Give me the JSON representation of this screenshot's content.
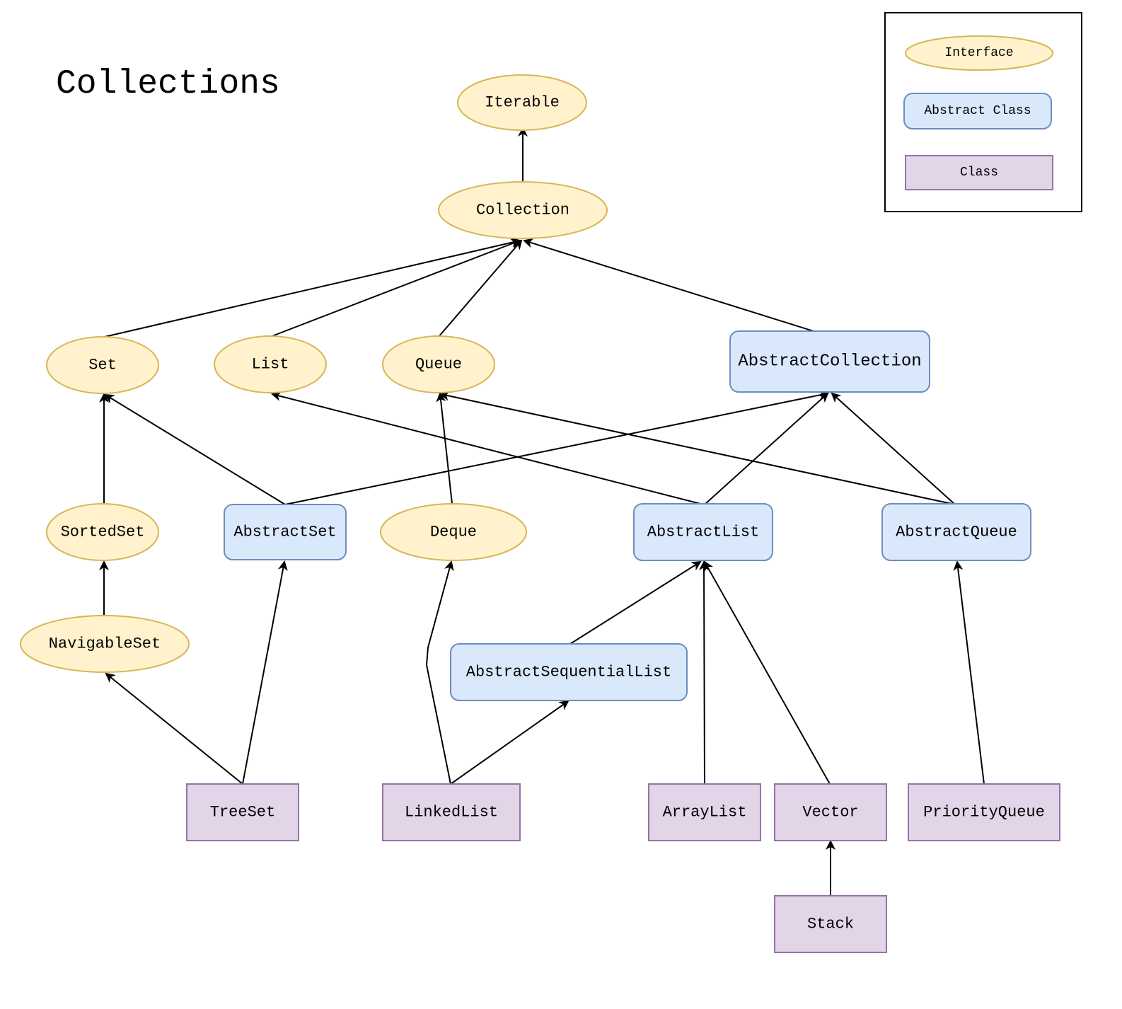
{
  "title": "Collections",
  "colors": {
    "interface_fill": "#fff2cc",
    "interface_stroke": "#d6b656",
    "abstract_fill": "#dae8fc",
    "abstract_stroke": "#6c8ebf",
    "class_fill": "#e1d5e7",
    "class_stroke": "#9673a6",
    "edge": "#000000"
  },
  "legend": {
    "items": [
      {
        "kind": "interface",
        "label": "Interface"
      },
      {
        "kind": "abstract",
        "label": "Abstract Class"
      },
      {
        "kind": "class",
        "label": "Class"
      }
    ]
  },
  "nodes": [
    {
      "id": "iterable",
      "kind": "interface",
      "label": "Iterable"
    },
    {
      "id": "collection",
      "kind": "interface",
      "label": "Collection"
    },
    {
      "id": "set",
      "kind": "interface",
      "label": "Set"
    },
    {
      "id": "list",
      "kind": "interface",
      "label": "List"
    },
    {
      "id": "queue",
      "kind": "interface",
      "label": "Queue"
    },
    {
      "id": "abstractcollection",
      "kind": "abstract",
      "label": "AbstractCollection"
    },
    {
      "id": "sortedset",
      "kind": "interface",
      "label": "SortedSet"
    },
    {
      "id": "abstractset",
      "kind": "abstract",
      "label": "AbstractSet"
    },
    {
      "id": "deque",
      "kind": "interface",
      "label": "Deque"
    },
    {
      "id": "abstractlist",
      "kind": "abstract",
      "label": "AbstractList"
    },
    {
      "id": "abstractqueue",
      "kind": "abstract",
      "label": "AbstractQueue"
    },
    {
      "id": "navigableset",
      "kind": "interface",
      "label": "NavigableSet"
    },
    {
      "id": "abstractsequentiallist",
      "kind": "abstract",
      "label": "AbstractSequentialList"
    },
    {
      "id": "treeset",
      "kind": "class",
      "label": "TreeSet"
    },
    {
      "id": "linkedlist",
      "kind": "class",
      "label": "LinkedList"
    },
    {
      "id": "arraylist",
      "kind": "class",
      "label": "ArrayList"
    },
    {
      "id": "vector",
      "kind": "class",
      "label": "Vector"
    },
    {
      "id": "priorityqueue",
      "kind": "class",
      "label": "PriorityQueue"
    },
    {
      "id": "stack",
      "kind": "class",
      "label": "Stack"
    }
  ],
  "edges": [
    {
      "from": "collection",
      "to": "iterable"
    },
    {
      "from": "set",
      "to": "collection"
    },
    {
      "from": "list",
      "to": "collection"
    },
    {
      "from": "queue",
      "to": "collection"
    },
    {
      "from": "abstractcollection",
      "to": "collection"
    },
    {
      "from": "sortedset",
      "to": "set"
    },
    {
      "from": "abstractset",
      "to": "set"
    },
    {
      "from": "abstractset",
      "to": "abstractcollection"
    },
    {
      "from": "deque",
      "to": "queue"
    },
    {
      "from": "abstractlist",
      "to": "list"
    },
    {
      "from": "abstractlist",
      "to": "abstractcollection"
    },
    {
      "from": "abstractqueue",
      "to": "queue"
    },
    {
      "from": "abstractqueue",
      "to": "abstractcollection"
    },
    {
      "from": "navigableset",
      "to": "sortedset"
    },
    {
      "from": "abstractsequentiallist",
      "to": "abstractlist"
    },
    {
      "from": "treeset",
      "to": "navigableset"
    },
    {
      "from": "treeset",
      "to": "abstractset"
    },
    {
      "from": "linkedlist",
      "to": "deque"
    },
    {
      "from": "linkedlist",
      "to": "abstractsequentiallist"
    },
    {
      "from": "arraylist",
      "to": "abstractlist"
    },
    {
      "from": "vector",
      "to": "abstractlist"
    },
    {
      "from": "priorityqueue",
      "to": "abstractqueue"
    },
    {
      "from": "stack",
      "to": "vector"
    }
  ]
}
